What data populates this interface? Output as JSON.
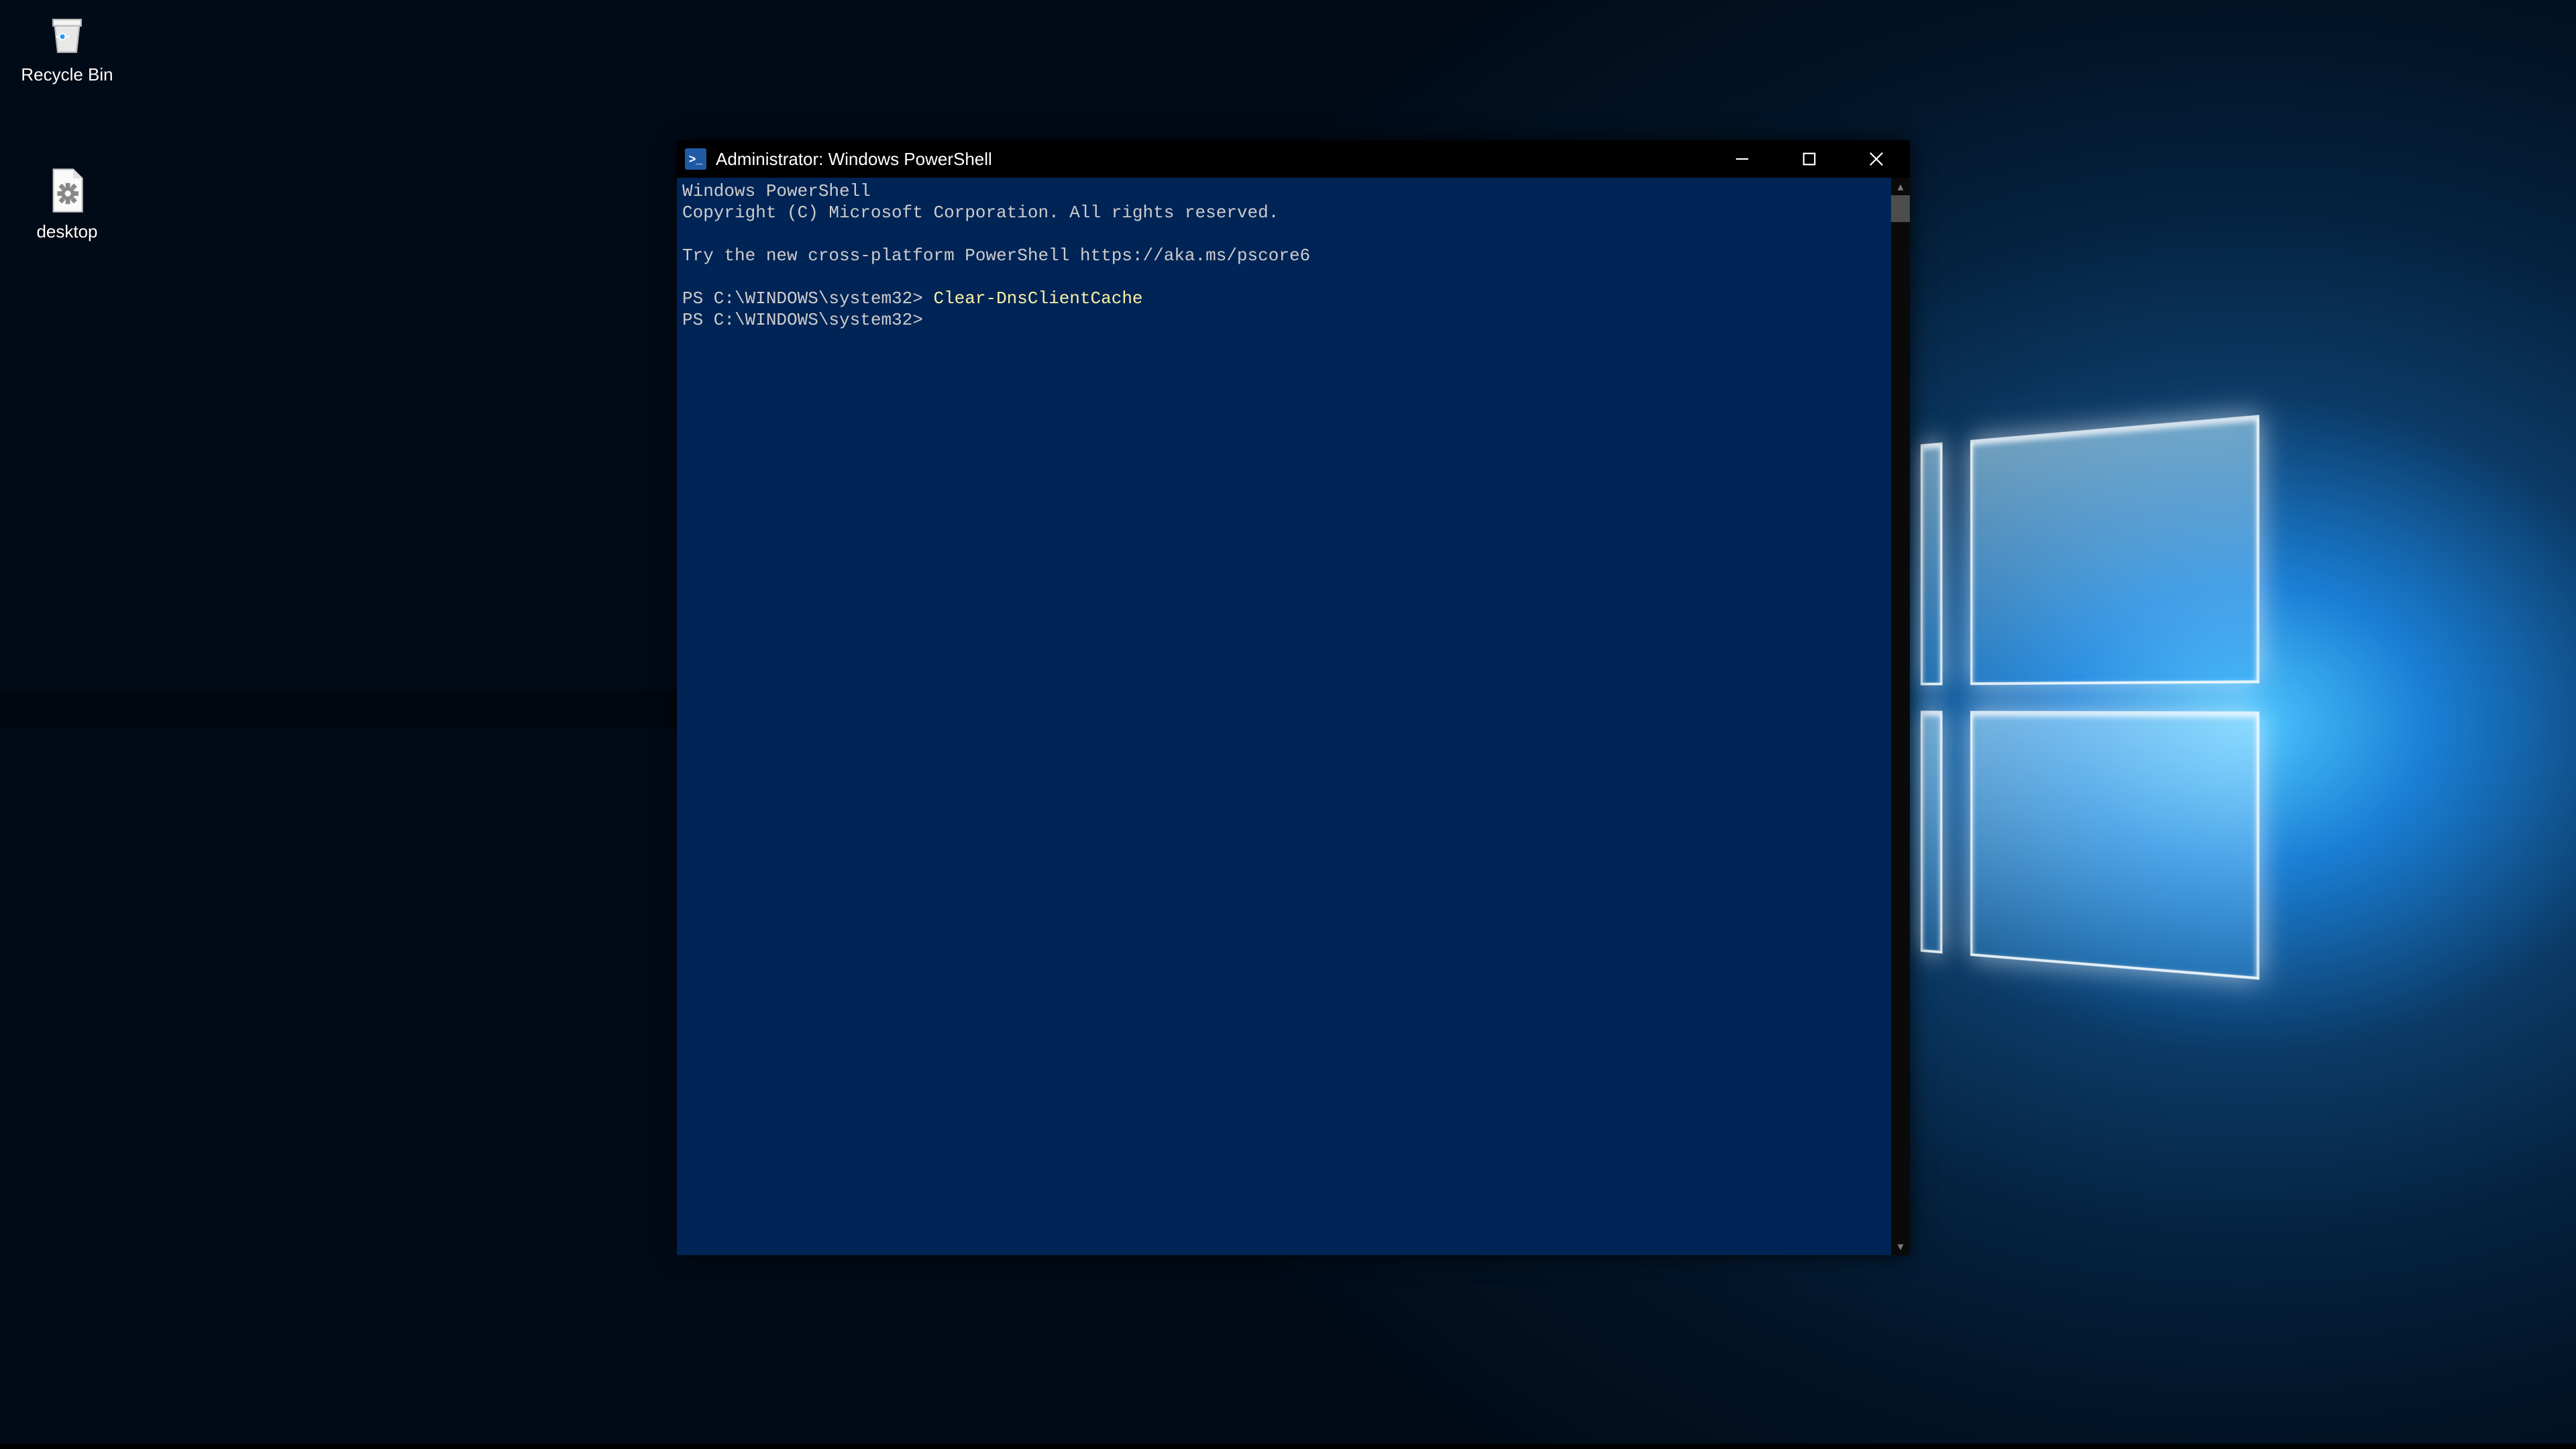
{
  "desktop": {
    "icons": [
      {
        "name": "recycle-bin",
        "label": "Recycle Bin"
      },
      {
        "name": "desktop-ini",
        "label": "desktop"
      }
    ]
  },
  "powershell": {
    "title": "Administrator: Windows PowerShell",
    "icon_label": ">_",
    "lines": {
      "l1": "Windows PowerShell",
      "l2": "Copyright (C) Microsoft Corporation. All rights reserved.",
      "l3": "",
      "l4": "Try the new cross-platform PowerShell https://aka.ms/pscore6",
      "l5": "",
      "p1": "PS C:\\WINDOWS\\system32> ",
      "c1": "Clear-DnsClientCache",
      "p2": "PS C:\\WINDOWS\\system32>"
    }
  }
}
